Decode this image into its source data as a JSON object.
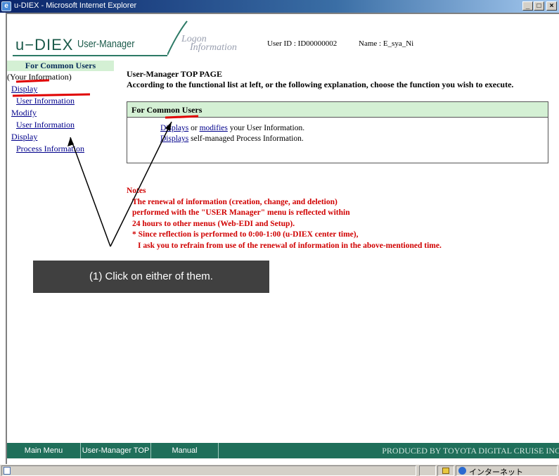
{
  "window": {
    "title": "u-DIEX - Microsoft Internet Explorer",
    "buttons": [
      "_",
      "□",
      "×"
    ]
  },
  "header": {
    "logo": "u−DIEX",
    "subtitle": "User-Manager",
    "logon_line1": "Logon",
    "logon_line2": "Information",
    "user_id": "User ID : ID00000002",
    "user_name": "Name : E_sya_Ni"
  },
  "sidebar": {
    "heading": "For Common Users",
    "section_label": "(Your Information)",
    "items": [
      {
        "label1": "Display",
        "label2": "User Information"
      },
      {
        "label1": "Modify",
        "label2": "User Information"
      },
      {
        "label1": "Display",
        "label2": "Process Information"
      }
    ]
  },
  "main": {
    "title": "User-Manager  TOP PAGE",
    "instructions": "According to the functional list at left, or the following explanation, choose the function you wish to execute.",
    "box_heading": "For Common Users",
    "row1": {
      "link1": "Displays",
      "mid": "or",
      "link2": "modifies",
      "rest": "your User Information."
    },
    "row2": {
      "link": "Displays",
      "rest": "self-managed Process Information."
    }
  },
  "notes": {
    "heading": "Notes",
    "lines": [
      "The renewal of information (creation, change, and deletion)",
      "performed with the \"USER Manager\" menu is reflected within",
      "24 hours to other menus (Web-EDI and Setup).",
      "* Since reflection is performed to 0:00-1:00 (u-DIEX center time),",
      "I ask you to refrain from use of the renewal of information in the above-mentioned time."
    ]
  },
  "callout": {
    "text": "(1) Click on either of them."
  },
  "bottom_nav": {
    "main_menu": "Main Menu",
    "top": "User-Manager TOP",
    "manual": "Manual",
    "credit": "PRODUCED BY TOYOTA DIGITAL CRUISE INC"
  },
  "status_bar": {
    "zone": "インターネット"
  },
  "colors": {
    "brand_green": "#1f6f5a",
    "box_header": "#d4f0d4",
    "notes_red": "#d00000",
    "annotation_red": "#e00000"
  }
}
